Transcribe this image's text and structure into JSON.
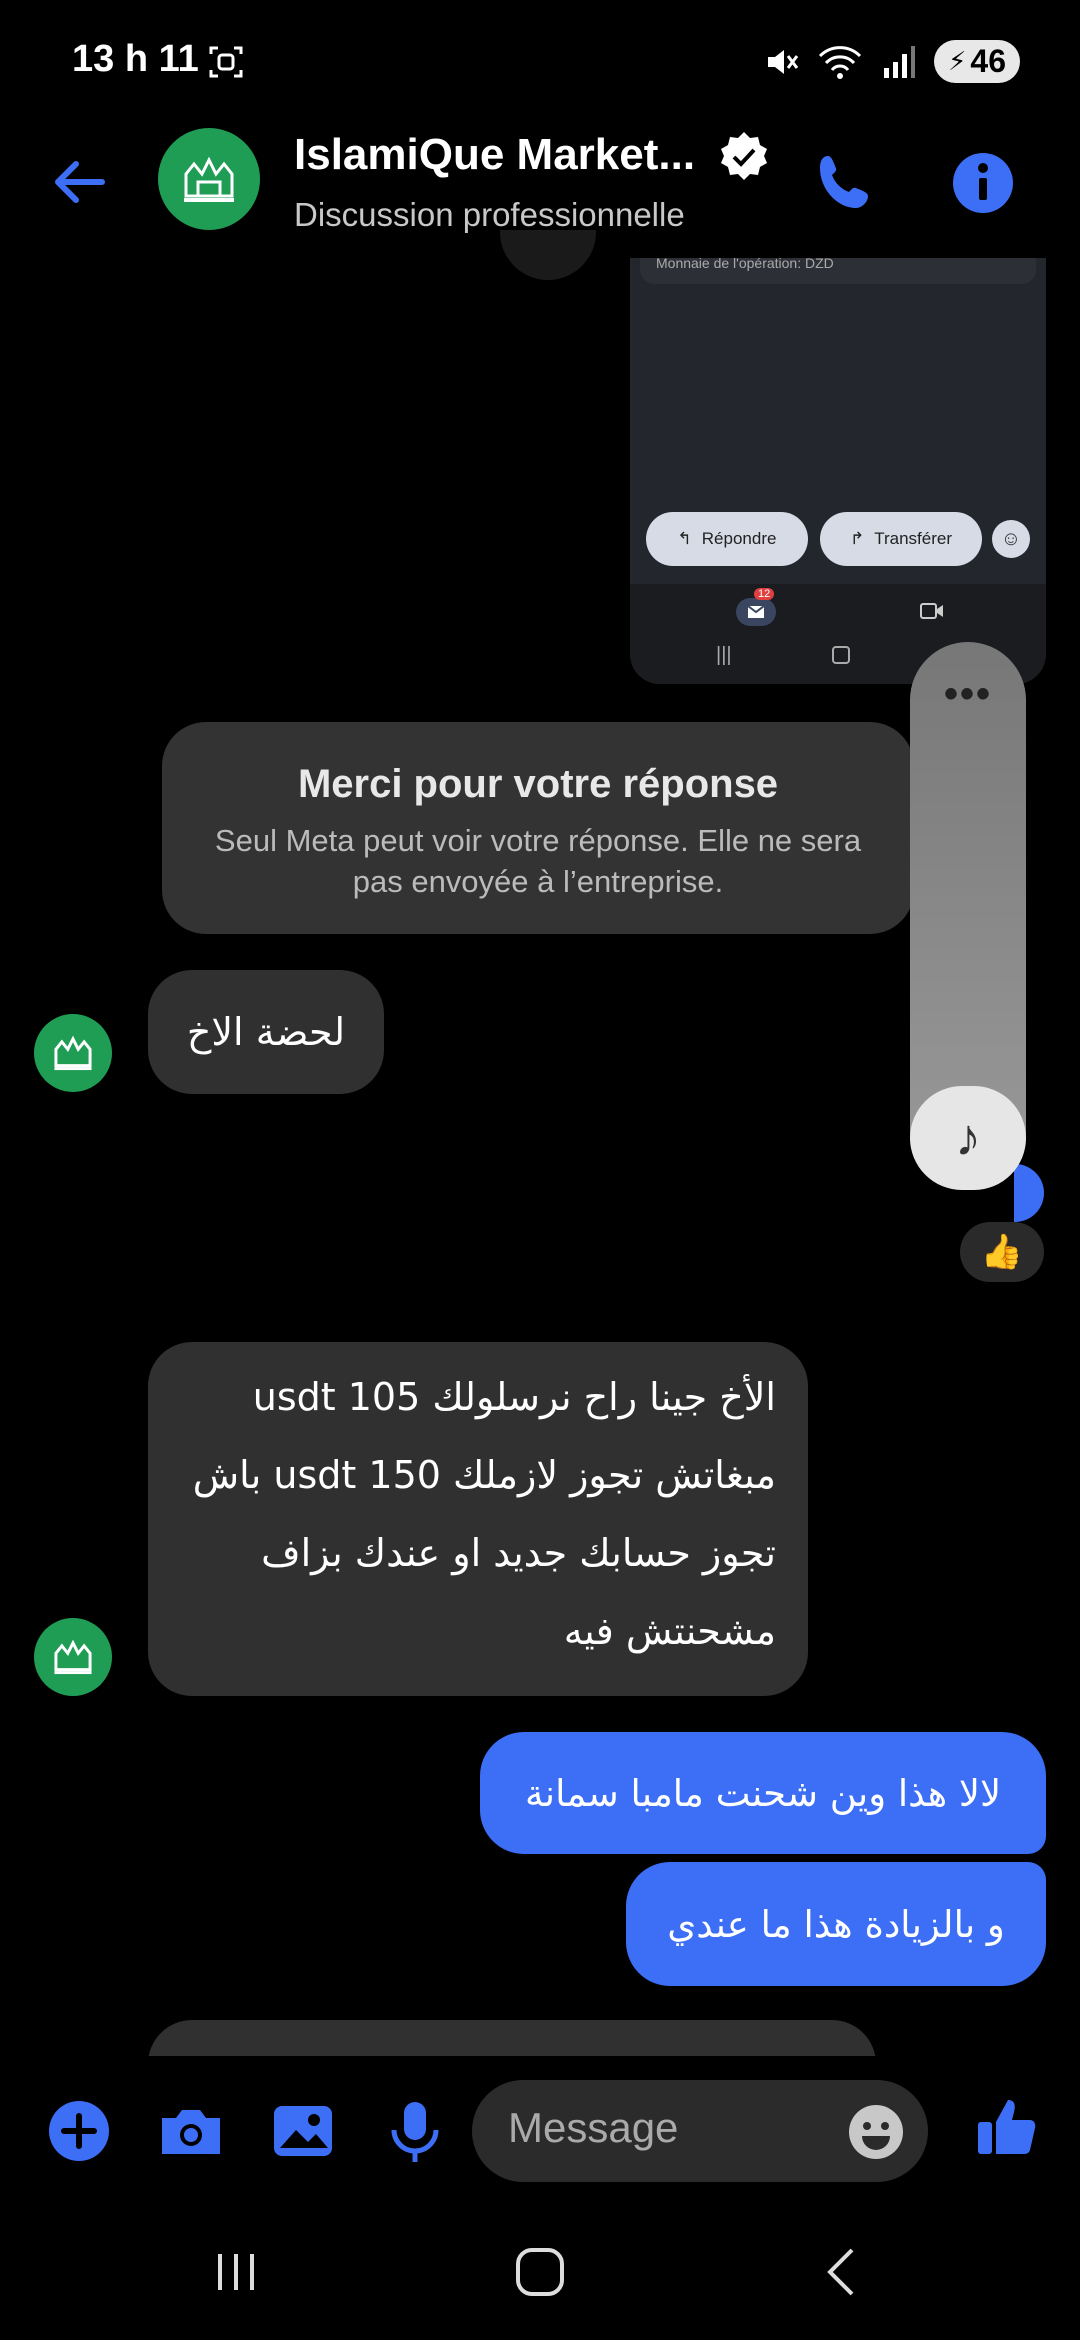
{
  "status_bar": {
    "time": "13 h 11",
    "battery": "46"
  },
  "header": {
    "title": "IslamiQue Market...",
    "subtitle": "Discussion professionnelle"
  },
  "shared_screenshot": {
    "top_text": "Monnaie de l'opération: DZD",
    "reply_label": "Répondre",
    "forward_label": "Transférer",
    "badge_count": "12"
  },
  "meta_card": {
    "title": "Merci pour votre réponse",
    "body": "Seul Meta peut voir votre réponse. Elle ne sera pas envoyée à l’entreprise."
  },
  "messages": [
    {
      "direction": "in",
      "text": "لحضة الاخ"
    },
    {
      "direction": "in",
      "lines": [
        "الأخ جينا راح نرسلولك 105 usdt",
        "مبغاتش تجوز لازملك 150 usdt باش",
        "تجوز حسابك جديد او عندك بزاف",
        "مشحنتش فيه"
      ]
    },
    {
      "direction": "out",
      "text": "لالا هذا وين شحنت مامبا سمانة"
    },
    {
      "direction": "out",
      "text": "و بالزيادة هذا ما عندي"
    }
  ],
  "reaction": "👍",
  "music_player": {
    "menu": "•••",
    "icon": "♪"
  },
  "composer": {
    "placeholder": "Message"
  },
  "colors": {
    "accent": "#3d6ef6",
    "incoming_bubble": "#303030",
    "avatar_green": "#1f9d55"
  }
}
